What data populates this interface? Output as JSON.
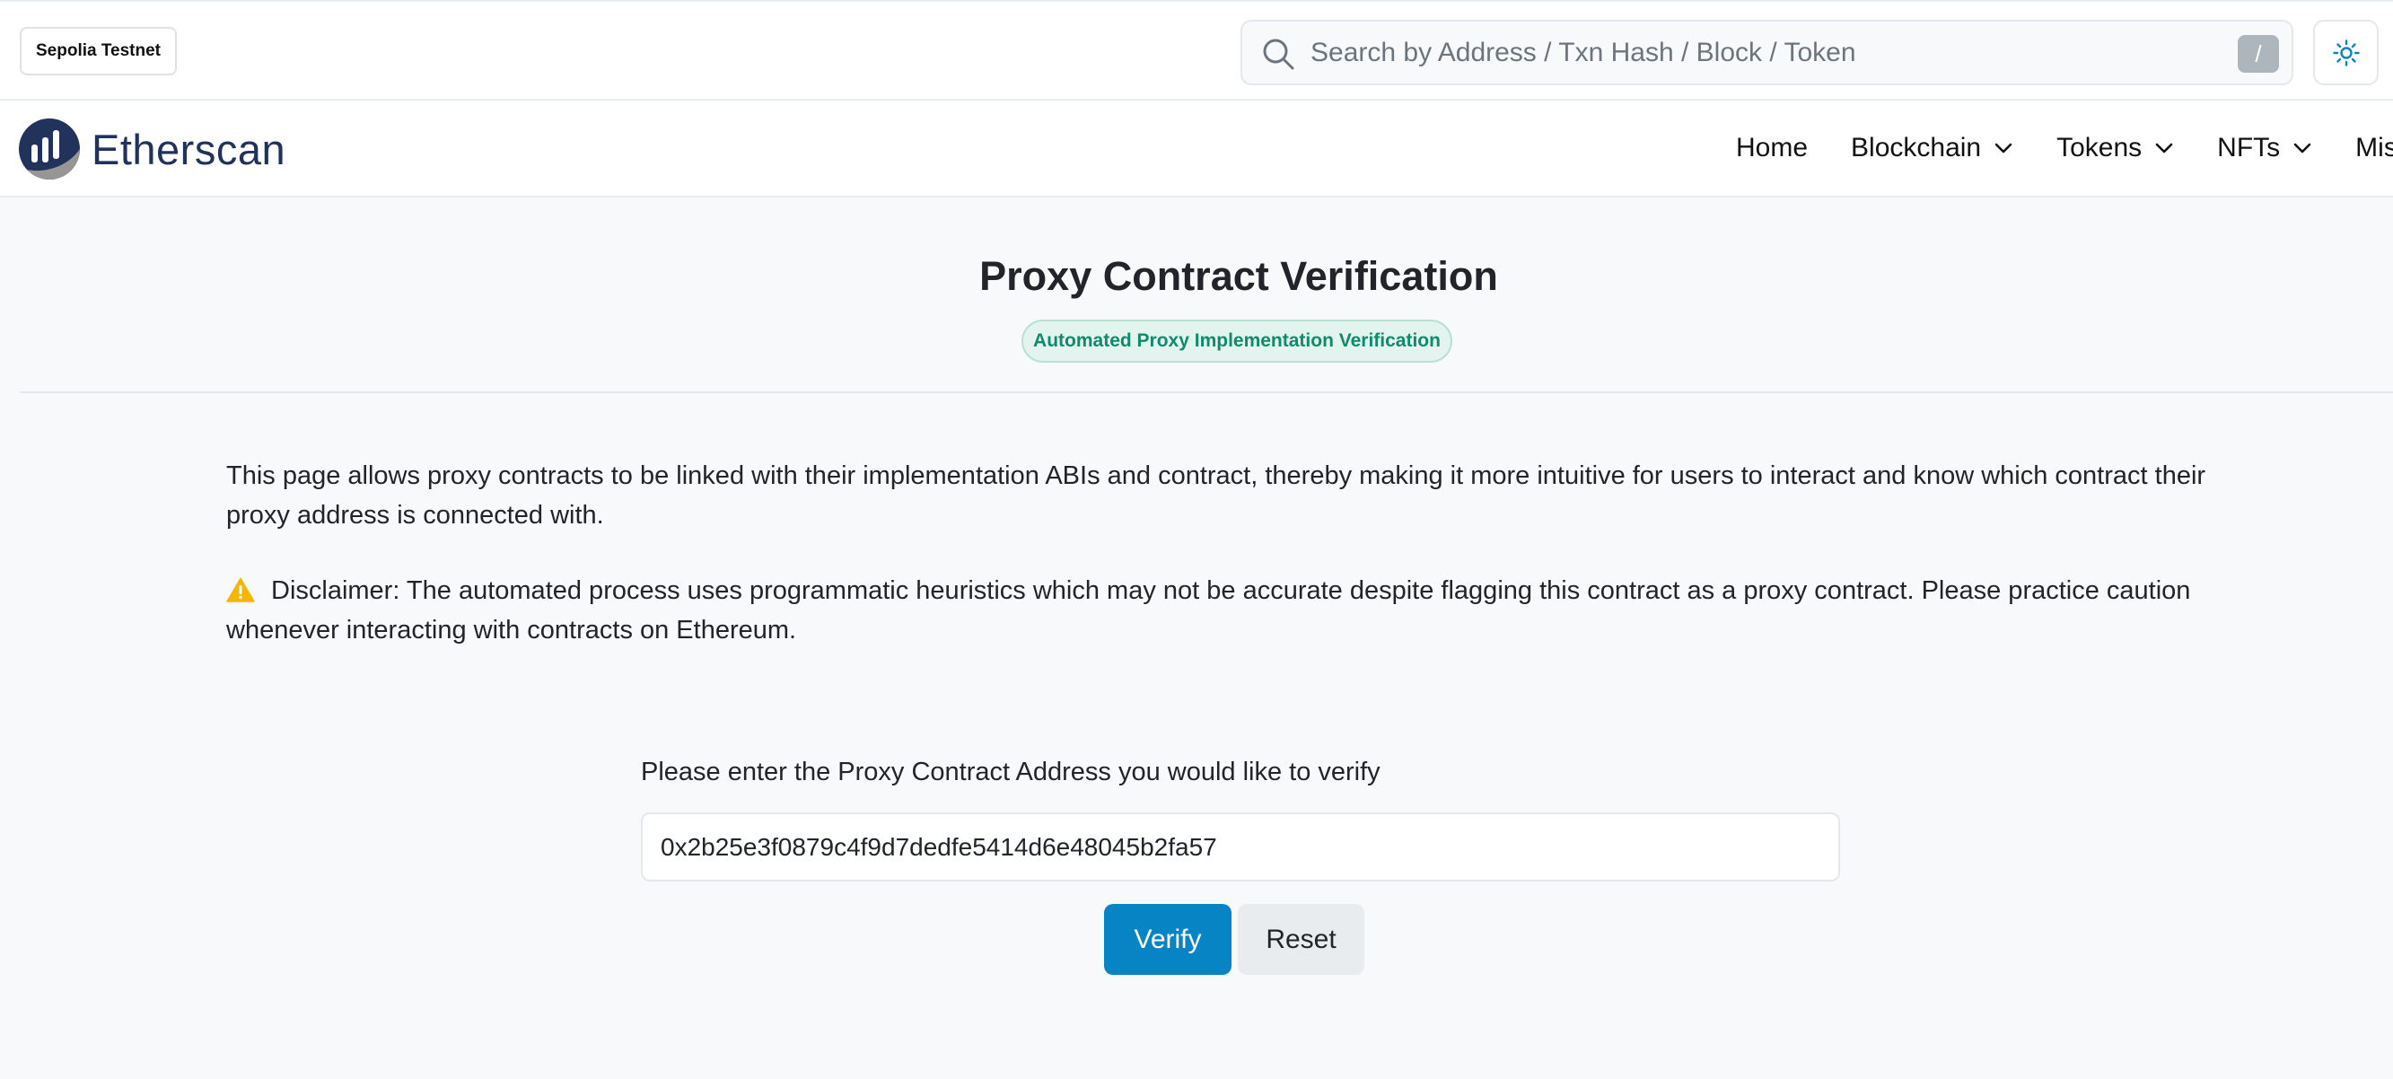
{
  "topbar": {
    "network_badge": "Sepolia Testnet",
    "search": {
      "placeholder": "Search by Address / Txn Hash / Block / Token",
      "value": "",
      "shortcut_key": "/"
    },
    "theme_icon": "sun-icon"
  },
  "navbar": {
    "logo_text": "Etherscan",
    "items": [
      {
        "label": "Home",
        "has_dropdown": false
      },
      {
        "label": "Blockchain",
        "has_dropdown": true
      },
      {
        "label": "Tokens",
        "has_dropdown": true
      },
      {
        "label": "NFTs",
        "has_dropdown": true
      },
      {
        "label": "Mis",
        "has_dropdown": false
      }
    ]
  },
  "main": {
    "title": "Proxy Contract Verification",
    "badge": "Automated Proxy Implementation Verification",
    "intro": "This page allows proxy contracts to be linked with their implementation ABIs and contract, thereby making it more intuitive for users to interact and know which contract their proxy address is connected with.",
    "disclaimer": "Disclaimer: The automated process uses programmatic heuristics which may not be accurate despite flagging this contract as a proxy contract. Please practice caution whenever interacting with contracts on Ethereum.",
    "form": {
      "label": "Please enter the Proxy Contract Address you would like to verify",
      "address_value": "0x2b25e3f0879c4f9d7dedfe5414d6e48045b2fa57",
      "verify_label": "Verify",
      "reset_label": "Reset"
    }
  },
  "colors": {
    "primary": "#0784c3",
    "badge_text": "#0f8a6b",
    "badge_bg": "#e3f4ef",
    "warning": "#f7b500",
    "logo": "#21325b"
  }
}
